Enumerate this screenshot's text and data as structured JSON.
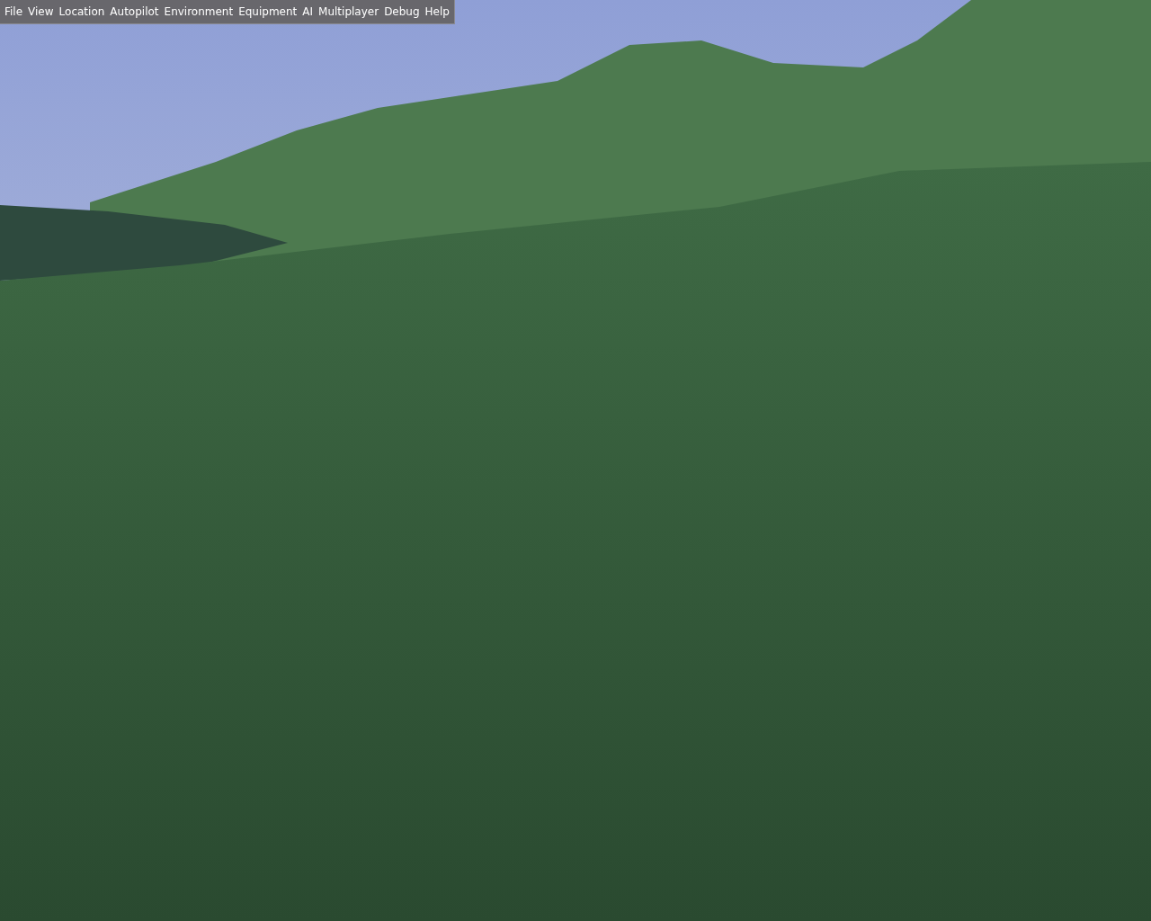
{
  "menu_bar": {
    "items": [
      {
        "label": "File"
      },
      {
        "label": "View"
      },
      {
        "label": "Location"
      },
      {
        "label": "Autopilot"
      },
      {
        "label": "Environment"
      },
      {
        "label": "Equipment"
      },
      {
        "label": "AI"
      },
      {
        "label": "Multiplayer"
      },
      {
        "label": "Debug"
      },
      {
        "label": "Help"
      }
    ]
  }
}
